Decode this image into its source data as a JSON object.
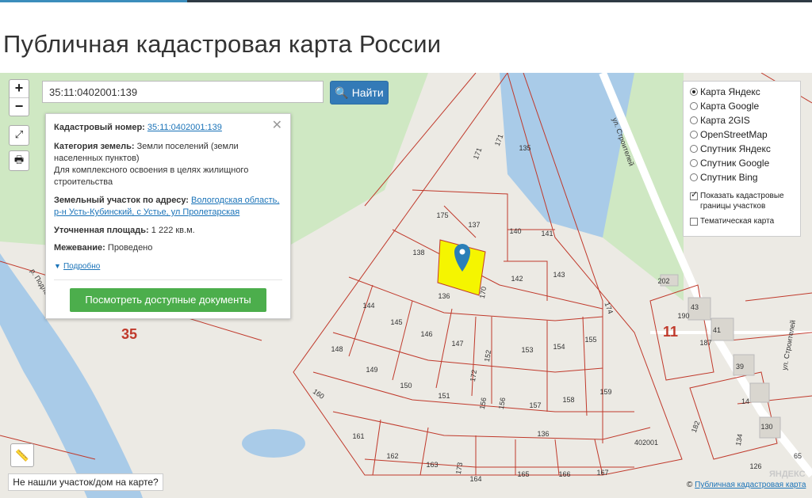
{
  "page": {
    "title": "Публичная кадастровая карта России"
  },
  "search": {
    "value": "35:11:0402001:139",
    "button_label": "Найти"
  },
  "map_controls": {
    "zoom_in": "+",
    "zoom_out": "−"
  },
  "info_card": {
    "cadastral_label": "Кадастровый номер:",
    "cadastral_value": "35:11:0402001:139",
    "category_label": "Категория земель:",
    "category_value": "Земли поселений (земли населенных пунктов)",
    "purpose_value": "Для комплексного освоения в целях жилищного строительства",
    "address_label": "Земельный участок по адресу:",
    "address_line1": "Вологодская область,",
    "address_line2": "р-н Усть-Кубинский, с Устье, ул Пролетарская",
    "area_label": "Уточненная площадь:",
    "area_value": "1 222 кв.м.",
    "survey_label": "Межевание:",
    "survey_value": "Проведено",
    "more_link": "Подробно",
    "docs_button": "Посмотреть доступные документы"
  },
  "layers": {
    "options": [
      "Карта Яндекс",
      "Карта Google",
      "Карта 2GIS",
      "OpenStreetMap",
      "Спутник Яндекс",
      "Спутник Google",
      "Спутник Bing"
    ],
    "selected": "Карта Яндекс",
    "checkbox_borders": "Показать кадастровые границы участков",
    "checkbox_thematic": "Тематическая карта"
  },
  "not_found_button": "Не нашли участок/дом на карте?",
  "copyright": {
    "prefix": "©",
    "link": "Публичная кадастровая карта"
  },
  "watermark": "ЯНДЕКС",
  "map_labels": {
    "river": "р. Подлесная",
    "street1": "ул. Строителей",
    "street2": "ул. Строителей",
    "district": "35",
    "block": "11",
    "quarter": "402001",
    "parcels": [
      "171",
      "171",
      "135",
      "175",
      "137",
      "140",
      "141",
      "138",
      "142",
      "143",
      "136",
      "170",
      "144",
      "145",
      "146",
      "147",
      "152",
      "153",
      "154",
      "155",
      "148",
      "149",
      "172",
      "150",
      "151",
      "156",
      "156",
      "157",
      "158",
      "159",
      "160",
      "161",
      "162",
      "163",
      "173",
      "164",
      "165",
      "166",
      "167",
      "136",
      "174",
      "202",
      "190",
      "43",
      "41",
      "187",
      "39",
      "182",
      "134",
      "14",
      "130",
      "126",
      "65"
    ]
  },
  "colors": {
    "selected_parcel": "#f5f500",
    "boundary": "#c0392b",
    "green_area": "#cfe8c3",
    "water": "#a9cbe8",
    "primary_button": "#337ab7",
    "docs_button": "#4cae4c"
  }
}
